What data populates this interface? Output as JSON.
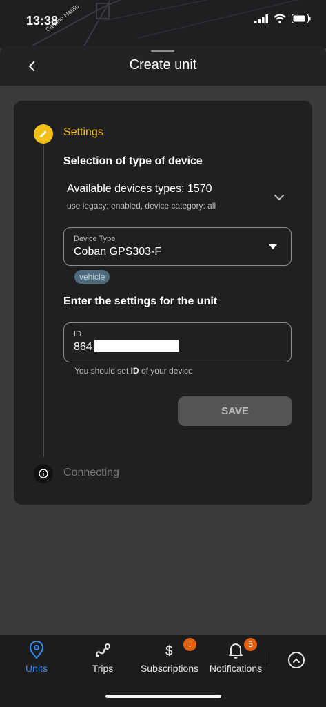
{
  "status_bar": {
    "time": "13:38",
    "street": "Camino Hatillo"
  },
  "header": {
    "title": "Create unit"
  },
  "steps": {
    "settings_label": "Settings",
    "connecting_label": "Connecting"
  },
  "device_selection": {
    "heading": "Selection of type of device",
    "available_title": "Available devices types: 1570",
    "available_subtitle": "use legacy: enabled, device category: all",
    "device_type_label": "Device Type",
    "device_type_value": "Coban GPS303-F",
    "category_chip": "vehicle"
  },
  "unit_settings": {
    "heading": "Enter the settings for the unit",
    "id_label": "ID",
    "id_value": "864",
    "helper_prefix": "You should set ",
    "helper_bold": "ID",
    "helper_suffix": " of your device",
    "save_label": "SAVE"
  },
  "tabs": [
    {
      "label": "Units",
      "icon": "location-pin-icon",
      "active": true
    },
    {
      "label": "Trips",
      "icon": "route-icon",
      "active": false
    },
    {
      "label": "Subscriptions",
      "icon": "dollar-icon",
      "badge": "!",
      "active": false
    },
    {
      "label": "Notifications",
      "icon": "bell-icon",
      "badge": "5",
      "active": false
    }
  ],
  "colors": {
    "accent": "#f2c018",
    "active_tab": "#2f8cf0",
    "badge": "#e06010",
    "card": "#202022"
  }
}
